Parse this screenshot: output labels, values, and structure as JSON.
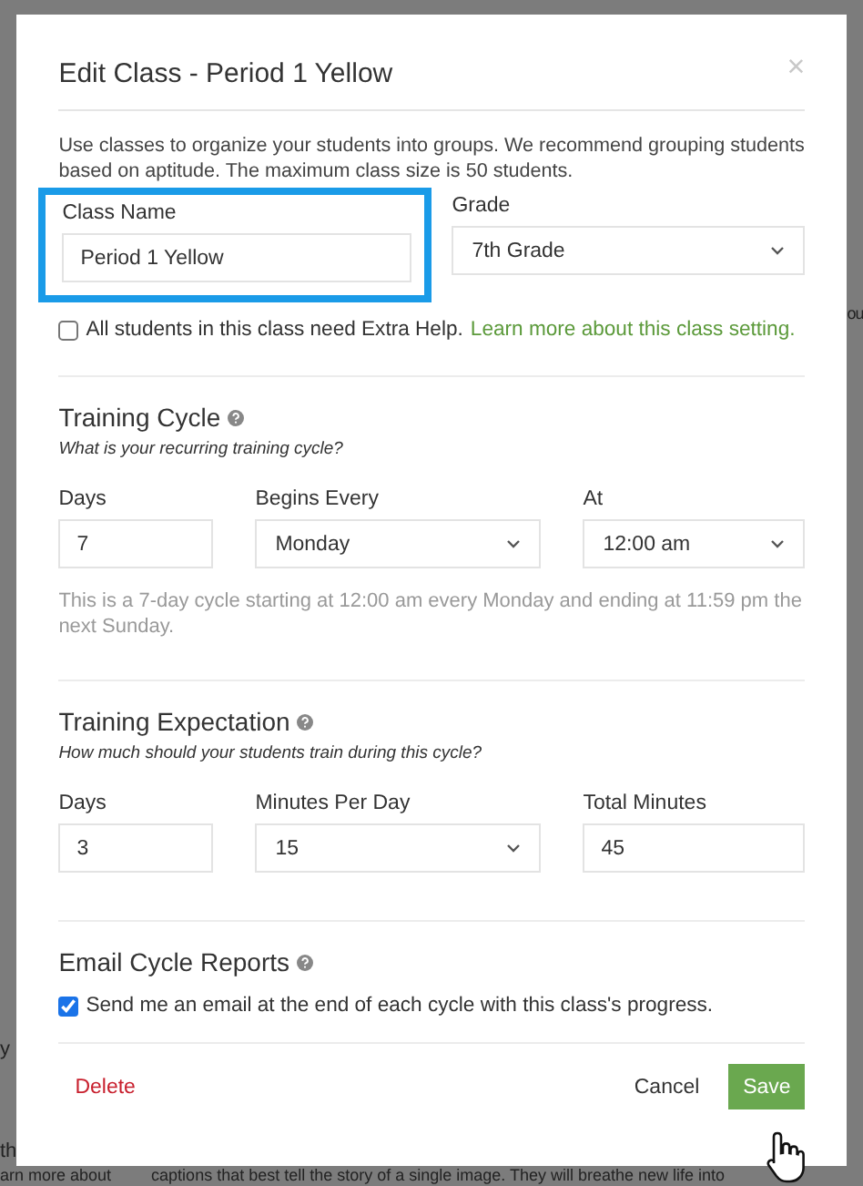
{
  "background": {
    "left_fragments": [
      "y",
      "th"
    ],
    "right_fragment": "ou",
    "bottom_left": "arn more about",
    "bottom_right": "captions that best tell the story of a single image. They will breathe new life into"
  },
  "dialog": {
    "title": "Edit Class - Period 1 Yellow",
    "close": "×",
    "description": "Use classes to organize your students into groups. We recommend grouping students based on aptitude. The maximum class size is 50 students.",
    "class_name": {
      "label": "Class Name",
      "value": "Period 1 Yellow",
      "highlighted": true
    },
    "grade": {
      "label": "Grade",
      "value": "7th Grade"
    },
    "extra_help": {
      "checked": false,
      "text": "All students in this class need Extra Help.",
      "link": "Learn more about this class setting."
    },
    "sections": [
      {
        "title": "Training Cycle",
        "subtitle": "What is your recurring training cycle?",
        "fields": [
          {
            "kind": "input",
            "label": "Days",
            "value": "7"
          },
          {
            "kind": "select",
            "label": "Begins Every",
            "value": "Monday"
          },
          {
            "kind": "select",
            "label": "At",
            "value": "12:00 am"
          }
        ],
        "note": "This is a 7-day cycle starting at 12:00 am every Monday and ending at 11:59 pm the next Sunday."
      },
      {
        "title": "Training Expectation",
        "subtitle": "How much should your students train during this cycle?",
        "fields": [
          {
            "kind": "input",
            "label": "Days",
            "value": "3"
          },
          {
            "kind": "select",
            "label": "Minutes Per Day",
            "value": "15"
          },
          {
            "kind": "input",
            "label": "Total Minutes",
            "value": "45"
          }
        ]
      }
    ],
    "email": {
      "title": "Email Cycle Reports",
      "checked": true,
      "text": "Send me an email at the end of each cycle with this class's progress."
    },
    "buttons": {
      "delete": "Delete",
      "cancel": "Cancel",
      "save": "Save"
    }
  }
}
